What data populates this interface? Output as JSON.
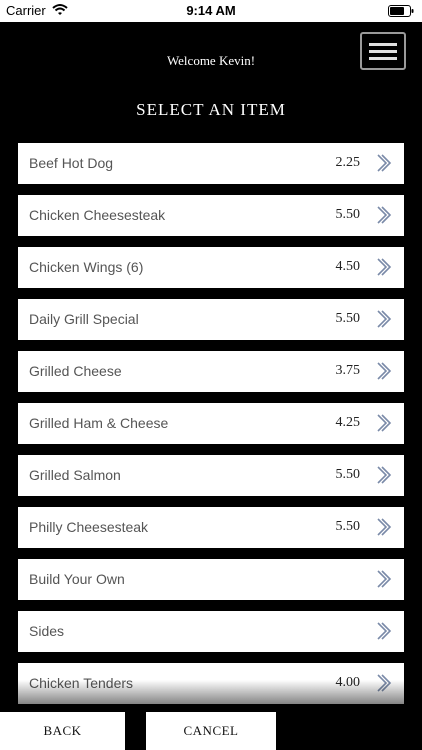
{
  "status_bar": {
    "carrier": "Carrier",
    "time": "9:14 AM"
  },
  "header": {
    "welcome": "Welcome Kevin!",
    "title": "SELECT AN ITEM",
    "menu_icon": "hamburger-menu-icon"
  },
  "items": [
    {
      "name": "Beef Hot Dog",
      "price": "2.25"
    },
    {
      "name": "Chicken Cheesesteak",
      "price": "5.50"
    },
    {
      "name": "Chicken Wings (6)",
      "price": "4.50"
    },
    {
      "name": "Daily Grill Special",
      "price": "5.50"
    },
    {
      "name": "Grilled Cheese",
      "price": "3.75"
    },
    {
      "name": "Grilled Ham & Cheese",
      "price": "4.25"
    },
    {
      "name": "Grilled Salmon",
      "price": "5.50"
    },
    {
      "name": "Philly Cheesesteak",
      "price": "5.50"
    },
    {
      "name": "Build Your Own",
      "price": ""
    },
    {
      "name": "Sides",
      "price": ""
    },
    {
      "name": "Chicken Tenders",
      "price": "4.00"
    }
  ],
  "footer": {
    "back": "BACK",
    "cancel": "CANCEL"
  },
  "colors": {
    "background": "#000000",
    "chevron": "#7a8aa8"
  }
}
